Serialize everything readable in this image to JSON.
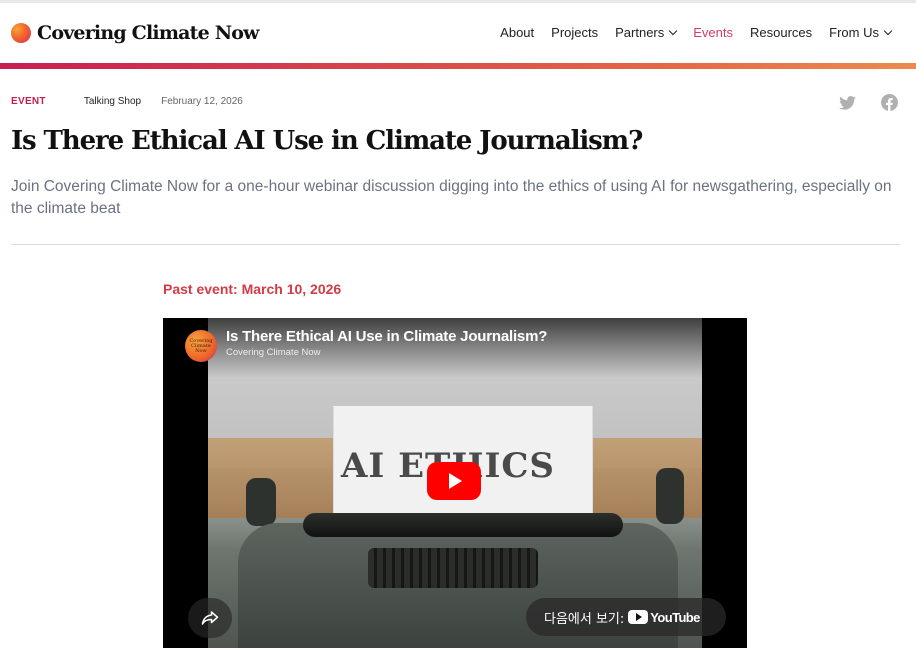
{
  "site": {
    "logo_text": "Covering Climate Now"
  },
  "nav": {
    "items": [
      {
        "label": "About",
        "dropdown": false,
        "active": false
      },
      {
        "label": "Projects",
        "dropdown": false,
        "active": false
      },
      {
        "label": "Partners",
        "dropdown": true,
        "active": false
      },
      {
        "label": "Events",
        "dropdown": false,
        "active": true
      },
      {
        "label": "Resources",
        "dropdown": false,
        "active": false
      },
      {
        "label": "From Us",
        "dropdown": true,
        "active": false
      }
    ]
  },
  "article": {
    "type": "EVENT",
    "series": "Talking Shop",
    "date": "February 12, 2026",
    "title": "Is There Ethical AI Use in Climate Journalism?",
    "subtitle": "Join Covering Climate Now for a one-hour webinar discussion digging into the ethics of using AI for newsgathering, especially on the climate beat",
    "past_event": "Past event: March 10, 2026"
  },
  "social": {
    "icons": [
      "twitter-icon",
      "facebook-icon"
    ]
  },
  "video": {
    "title": "Is There Ethical AI Use in Climate Journalism?",
    "channel": "Covering Climate Now",
    "avatar_text": "Covering Climate Now",
    "thumbnail_text": "AI ETHICS",
    "watch_on_label": "다음에서 보기:",
    "youtube_label": "YouTube"
  },
  "colors": {
    "accent_pink": "#c41e50",
    "nav_active": "#d63a6a",
    "past_event": "#d33b45",
    "subtitle_gray": "#6b7280"
  }
}
